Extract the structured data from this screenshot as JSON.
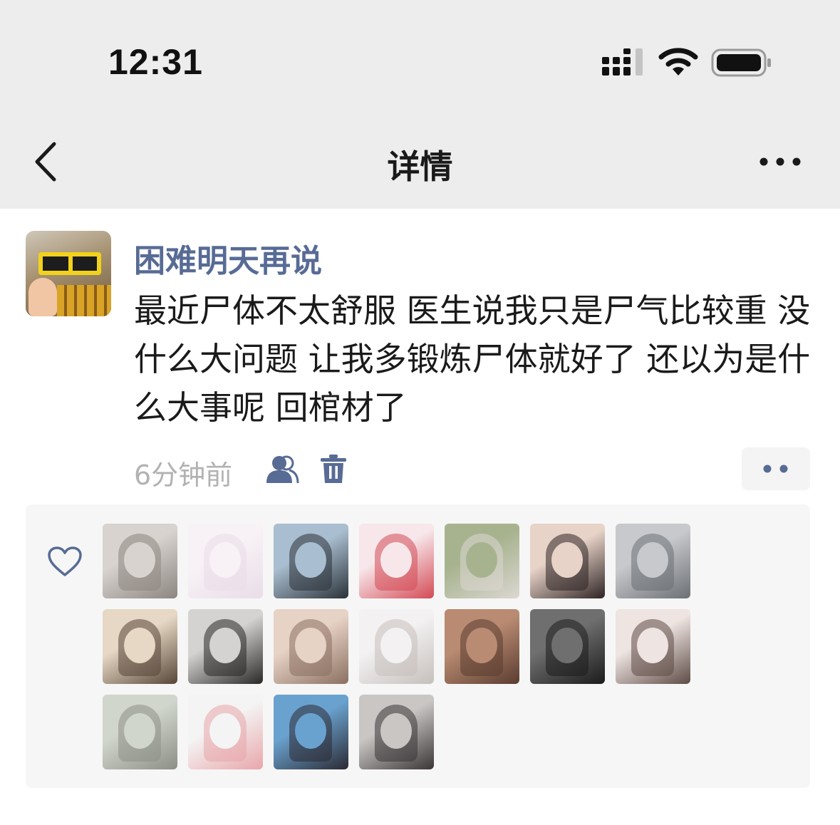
{
  "status_bar": {
    "time": "12:31"
  },
  "nav": {
    "title": "详情",
    "back_icon": "chevron-left-icon",
    "more_icon": "ellipsis-icon"
  },
  "post": {
    "username": "困难明天再说",
    "text": "最近尸体不太舒服 医生说我只是尸气比较重 没什么大问题 让我多锻炼尸体就好了 还以为是什么大事呢 回棺材了",
    "time": "6分钟前"
  },
  "likes": {
    "icon": "heart-outline-icon",
    "avatars": [
      {
        "colors": [
          "#d8d3cf",
          "#8c8580"
        ]
      },
      {
        "colors": [
          "#f8f2f6",
          "#e9dde8"
        ]
      },
      {
        "colors": [
          "#a9bed0",
          "#2b3238"
        ]
      },
      {
        "colors": [
          "#f7e7ea",
          "#d44a55"
        ]
      },
      {
        "colors": [
          "#a7b38f",
          "#dcd7d2"
        ]
      },
      {
        "colors": [
          "#e8d3c8",
          "#2e2424"
        ]
      },
      {
        "colors": [
          "#c7c9cc",
          "#6c6f74"
        ]
      },
      {
        "colors": [
          "#e6d8c4",
          "#574638"
        ]
      },
      {
        "colors": [
          "#d5d2d2",
          "#2a2727"
        ]
      },
      {
        "colors": [
          "#e7d2c6",
          "#8a7060"
        ]
      },
      {
        "colors": [
          "#f3f1f2",
          "#c6bfbc"
        ]
      },
      {
        "colors": [
          "#b98b72",
          "#5a3c30"
        ]
      },
      {
        "colors": [
          "#6f6f6f",
          "#1b1b1b"
        ]
      },
      {
        "colors": [
          "#eee4e1",
          "#5e4b45"
        ]
      },
      {
        "colors": [
          "#d1d6cd",
          "#8d8f86"
        ]
      },
      {
        "colors": [
          "#f4f4f4",
          "#e8a6aa"
        ]
      },
      {
        "colors": [
          "#6aa2cf",
          "#2b2a33"
        ]
      },
      {
        "colors": [
          "#c9c6c4",
          "#3b3536"
        ]
      }
    ]
  },
  "colors": {
    "nav_bg": "#ededed",
    "username": "#576b95",
    "meta_text": "#b2b2b2",
    "likes_bg": "#f6f6f6"
  }
}
